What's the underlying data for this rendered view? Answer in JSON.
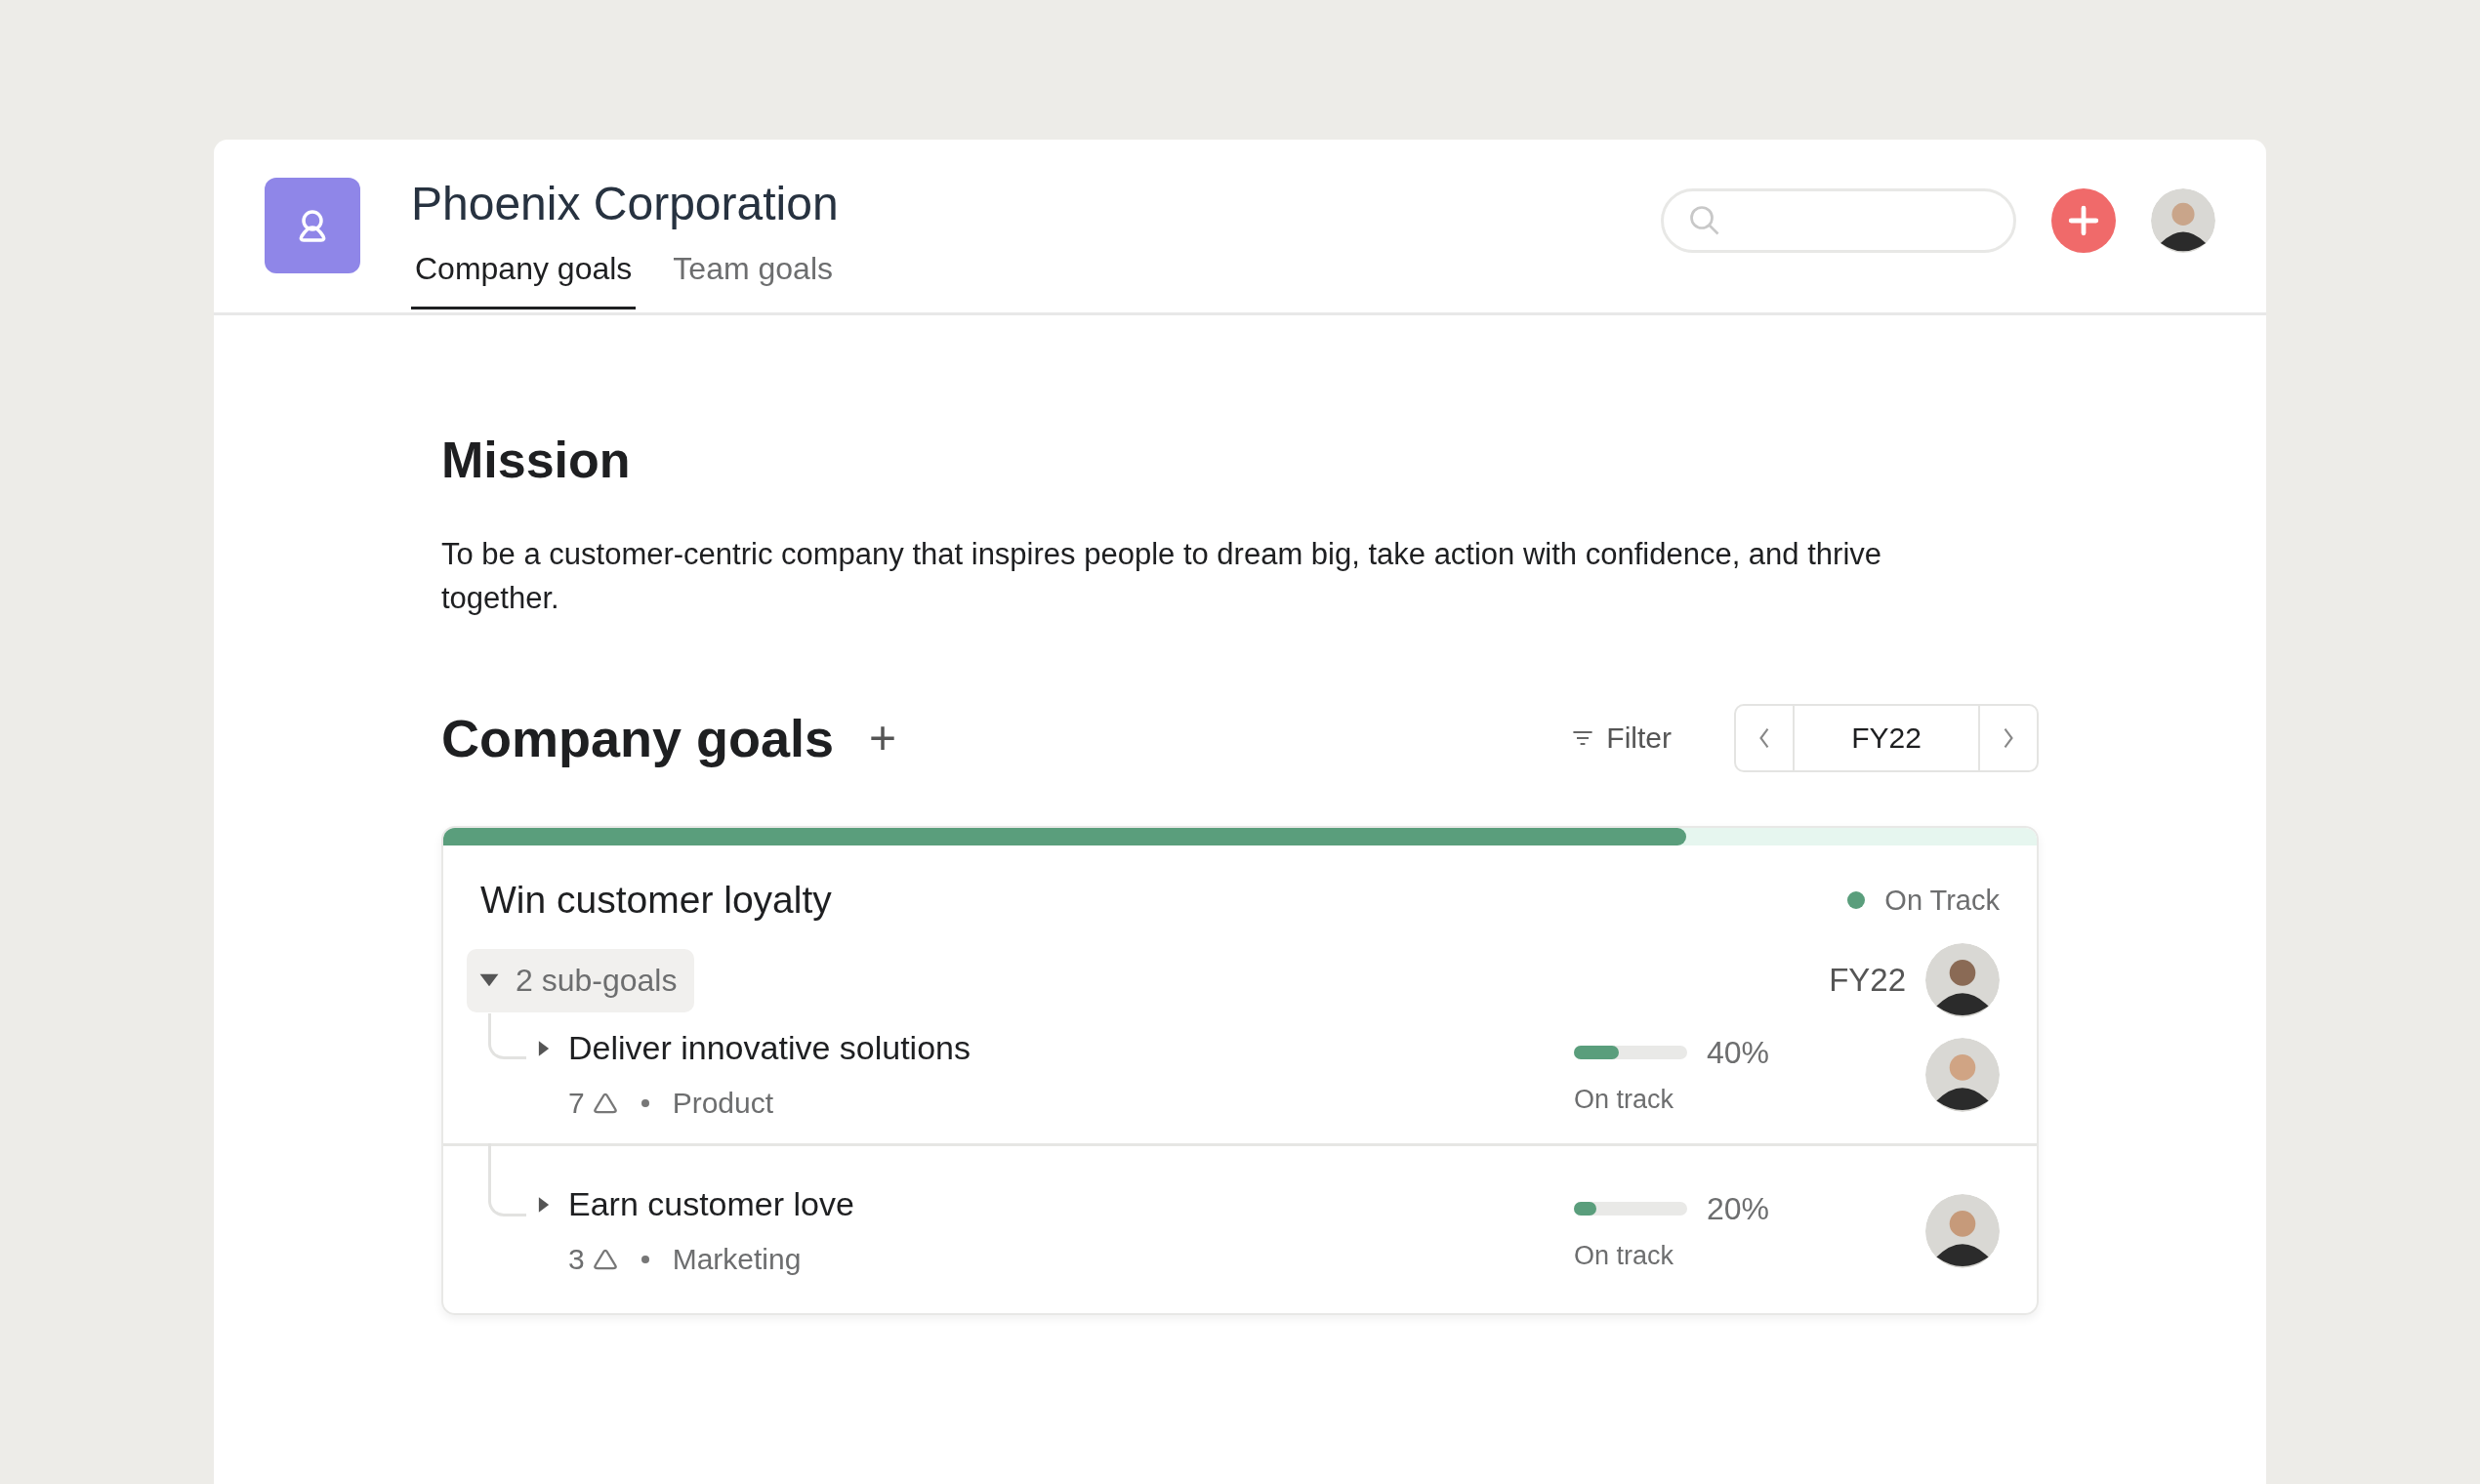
{
  "app": {
    "title": "Phoenix Corporation"
  },
  "tabs": [
    {
      "label": "Company goals",
      "selected": true
    },
    {
      "label": "Team goals",
      "selected": false
    }
  ],
  "mission": {
    "heading": "Mission",
    "text": "To be a customer-centric company that inspires people to dream big, take action with confidence, and thrive together."
  },
  "goals_section": {
    "heading": "Company goals",
    "add": "+",
    "filter": "Filter",
    "period": "FY22"
  },
  "goal": {
    "title": "Win customer loyalty",
    "level": 0.78,
    "status": "On Track",
    "color": "#5a9e7c",
    "subgoals_label": "2 sub-goals",
    "expanded": true,
    "period": "FY22",
    "children": [
      {
        "title": "Deliver innovative solutions",
        "expanded": false,
        "count": "7",
        "team": "Product",
        "level": 0.4,
        "percent": "40%",
        "status": "On track"
      },
      {
        "title": "Earn customer love",
        "expanded": false,
        "count": "3",
        "team": "Marketing",
        "level": 0.2,
        "percent": "20%",
        "status": "On track"
      }
    ]
  }
}
